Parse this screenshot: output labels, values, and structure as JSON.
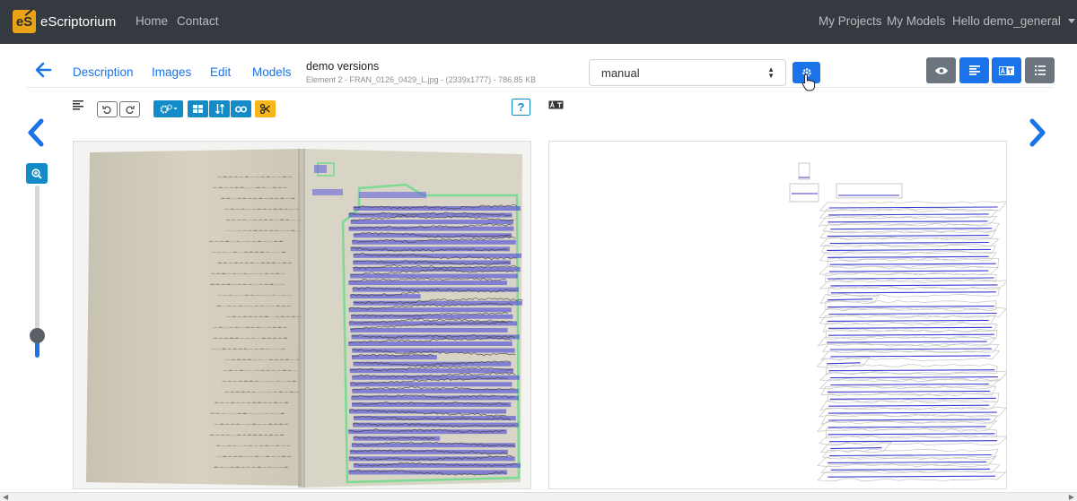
{
  "navbar": {
    "brand_logo": "eS",
    "brand_name": "eScriptorium",
    "links": {
      "home": "Home",
      "contact": "Contact",
      "projects": "My Projects",
      "models": "My Models",
      "user": "Hello demo_general"
    }
  },
  "tabs": {
    "description": "Description",
    "images": "Images",
    "edit": "Edit",
    "models": "Models"
  },
  "document": {
    "title": "demo versions",
    "subtitle": "Element 2 - FRAN_0126_0429_L.jpg - (2339x1777) - 786.85 KB"
  },
  "transcription_select": {
    "value": "manual"
  },
  "toolbar": {
    "help": "?"
  },
  "colors": {
    "navbar": "#343a40",
    "primary": "#1a73e8",
    "info": "#138bc7",
    "warning": "#f7b718",
    "secondary": "#6c757d",
    "line": "#4b4bd8",
    "region": "#6fdc8c"
  },
  "icons": [
    "brand-logo",
    "back-arrow-icon",
    "gear-icon",
    "eye-icon",
    "align-left-icon",
    "translate-icon",
    "list-icon",
    "undo-icon",
    "redo-icon",
    "settings-icon",
    "grid-icon",
    "sort-icon",
    "link-icon",
    "scissors-icon",
    "zoom-in-icon",
    "chevron-left-icon",
    "chevron-right-icon"
  ]
}
